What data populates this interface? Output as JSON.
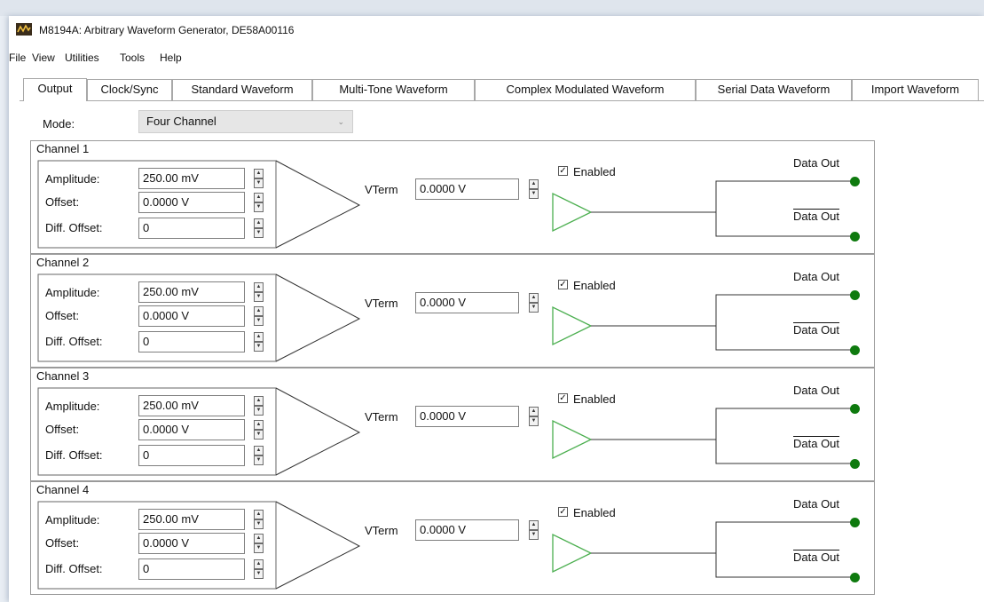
{
  "window": {
    "title": "M8194A: Arbitrary Waveform Generator, DE58A00116"
  },
  "menu": [
    "File",
    "View",
    "Utilities",
    "Tools",
    "Help"
  ],
  "tabs": [
    "Output",
    "Clock/Sync",
    "Standard Waveform",
    "Multi-Tone Waveform",
    "Complex Modulated Waveform",
    "Serial Data Waveform",
    "Import Waveform"
  ],
  "active_tab": "Output",
  "mode": {
    "label": "Mode:",
    "value": "Four Channel"
  },
  "labels": {
    "amplitude": "Amplitude:",
    "offset": "Offset:",
    "diff_offset": "Diff. Offset:",
    "vterm": "VTerm",
    "enabled": "Enabled",
    "data_out": "Data Out",
    "data_out_inv": "Data Out"
  },
  "channels": [
    {
      "title": "Channel 1",
      "amplitude": "250.00 mV",
      "offset": "0.0000 V",
      "diff_offset": "0",
      "vterm": "0.0000 V",
      "enabled": true
    },
    {
      "title": "Channel 2",
      "amplitude": "250.00 mV",
      "offset": "0.0000 V",
      "diff_offset": "0",
      "vterm": "0.0000 V",
      "enabled": true
    },
    {
      "title": "Channel 3",
      "amplitude": "250.00 mV",
      "offset": "0.0000 V",
      "diff_offset": "0",
      "vterm": "0.0000 V",
      "enabled": true
    },
    {
      "title": "Channel 4",
      "amplitude": "250.00 mV",
      "offset": "0.0000 V",
      "diff_offset": "0",
      "vterm": "0.0000 V",
      "enabled": true
    }
  ],
  "colors": {
    "amplifier": "#4caf50",
    "connector": "#0e7a0e",
    "tab_border": "#a8a8a8"
  }
}
